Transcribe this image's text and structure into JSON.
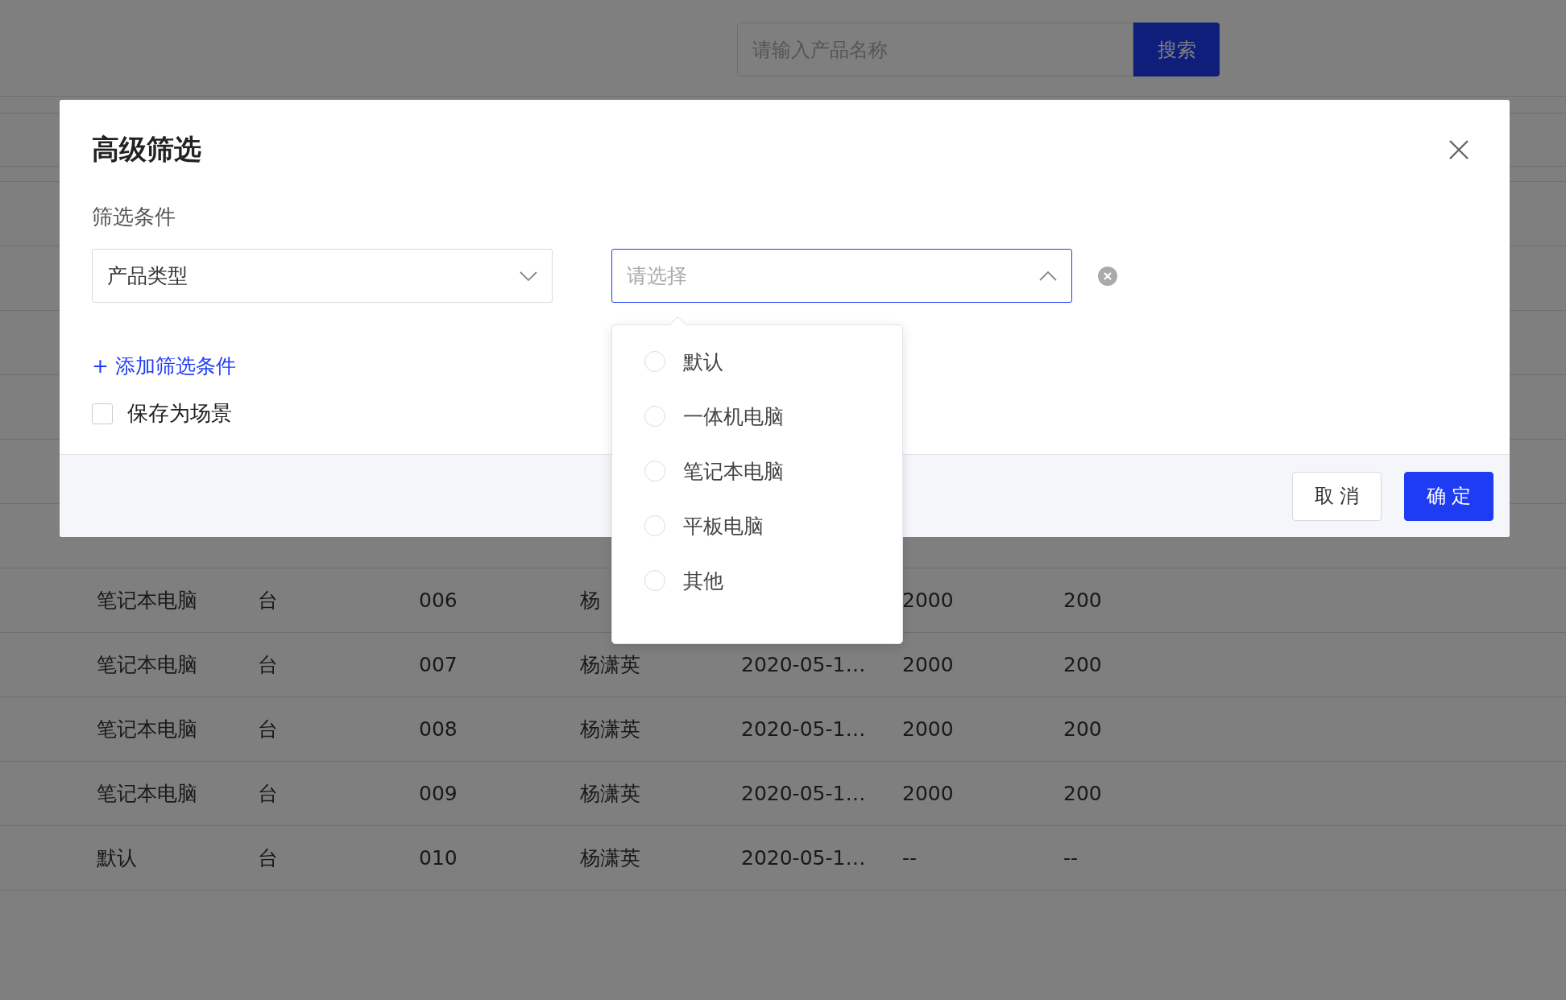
{
  "search": {
    "placeholder": "请输入产品名称",
    "button": "搜索"
  },
  "table": {
    "rows": [
      {
        "cells": [
          "笔记本电脑",
          "台",
          "006",
          "杨",
          null,
          "2000",
          "200"
        ]
      },
      {
        "cells": [
          "笔记本电脑",
          "台",
          "007",
          "杨潇英",
          "2020-05-1…",
          "2000",
          "200"
        ]
      },
      {
        "cells": [
          "笔记本电脑",
          "台",
          "008",
          "杨潇英",
          "2020-05-1…",
          "2000",
          "200"
        ]
      },
      {
        "cells": [
          "笔记本电脑",
          "台",
          "009",
          "杨潇英",
          "2020-05-1…",
          "2000",
          "200"
        ]
      },
      {
        "cells": [
          "默认",
          "台",
          "010",
          "杨潇英",
          "2020-05-1…",
          "--",
          "--"
        ]
      }
    ]
  },
  "dialog": {
    "title": "高级筛选",
    "section_label": "筛选条件",
    "condition": {
      "field": {
        "value": "产品类型"
      },
      "value_select": {
        "placeholder": "请选择",
        "expanded": true,
        "options": [
          {
            "label": "默认",
            "selected": false
          },
          {
            "label": "一体机电脑",
            "selected": false
          },
          {
            "label": "笔记本电脑",
            "selected": false
          },
          {
            "label": "平板电脑",
            "selected": false
          },
          {
            "label": "其他",
            "selected": false
          }
        ]
      }
    },
    "add_link": "+ 添加筛选条件",
    "save_scene": {
      "label": "保存为场景",
      "checked": false
    },
    "buttons": [
      {
        "label": "取 消",
        "kind": "secondary"
      },
      {
        "label": "确 定",
        "kind": "primary"
      }
    ]
  }
}
